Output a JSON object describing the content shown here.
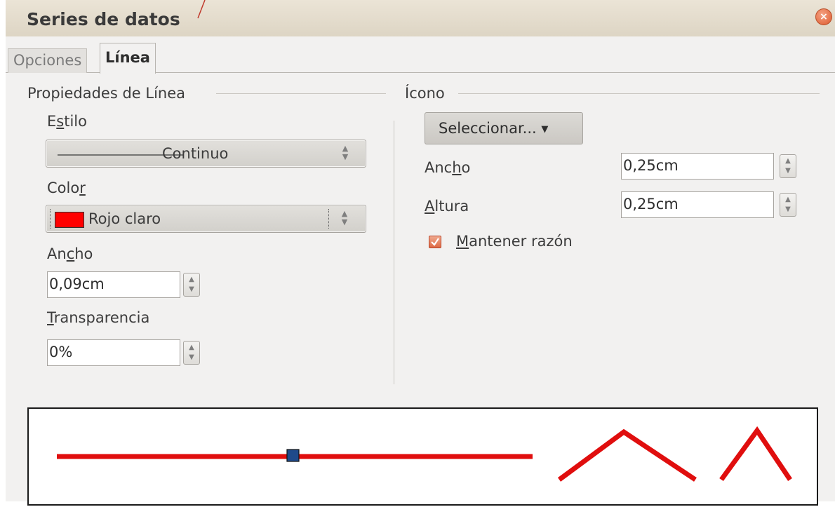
{
  "window": {
    "title": "Series de datos",
    "close_icon": "close-icon"
  },
  "tabs": [
    {
      "label": "Opciones",
      "active": false
    },
    {
      "label": "Línea",
      "active": true
    }
  ],
  "line_properties": {
    "group_label": "Propiedades de Línea",
    "style": {
      "label_pre": "E",
      "label_acc": "s",
      "label_post": "tilo",
      "value": "Continuo"
    },
    "color": {
      "label_pre": "Colo",
      "label_acc": "r",
      "label_post": "",
      "value": "Rojo claro",
      "swatch": "#ff0000"
    },
    "width": {
      "label_pre": "An",
      "label_acc": "c",
      "label_post": "ho",
      "value": "0,09cm"
    },
    "transparency": {
      "label_pre": "",
      "label_acc": "T",
      "label_post": "ransparencia",
      "value": "0%"
    }
  },
  "icon": {
    "group_label": "Ícono",
    "select_button": "Seleccionar...",
    "width": {
      "label_pre": "Anc",
      "label_acc": "h",
      "label_post": "o",
      "value": "0,25cm"
    },
    "height": {
      "label_pre": "",
      "label_acc": "A",
      "label_post": "ltura",
      "value": "0,25cm"
    },
    "keep_ratio": {
      "label_pre": "",
      "label_acc": "M",
      "label_post": "antener razón",
      "checked": true
    }
  },
  "preview": {
    "line_color": "#e00e0e",
    "marker_color": "#1f4a8a"
  },
  "colors": {
    "accent": "#de5a2e",
    "dialog_bg": "#f2f1f0"
  }
}
